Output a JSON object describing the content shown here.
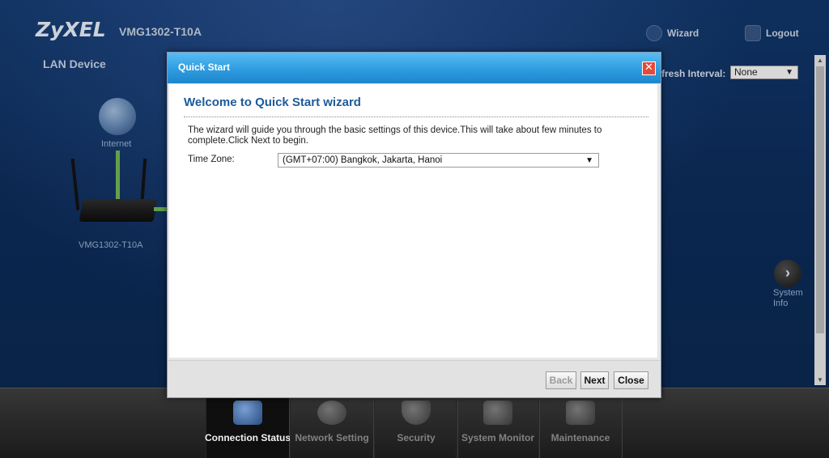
{
  "header": {
    "brand": "ZyXEL",
    "model": "VMG1302-T10A",
    "wizard_label": "Wizard",
    "logout_label": "Logout"
  },
  "page": {
    "section_title": "LAN Device",
    "refresh_label": "fresh Interval:",
    "refresh_value": "None",
    "internet_label": "Internet",
    "device_label": "VMG1302-T10A",
    "system_info_label_1": "System",
    "system_info_label_2": "Info"
  },
  "bottom_nav": {
    "items": [
      {
        "label": "Connection Status",
        "icon": "monitor-globe-icon",
        "active": true
      },
      {
        "label": "Network Setting",
        "icon": "gear-icon",
        "active": false
      },
      {
        "label": "Security",
        "icon": "shield-icon",
        "active": false
      },
      {
        "label": "System Monitor",
        "icon": "chart-monitor-icon",
        "active": false
      },
      {
        "label": "Maintenance",
        "icon": "tools-icon",
        "active": false
      }
    ]
  },
  "dialog": {
    "title": "Quick Start",
    "heading": "Welcome to Quick Start wizard",
    "intro": "The wizard will guide you through the basic settings of this device.This will take about few minutes to complete.Click Next to begin.",
    "timezone_label": "Time Zone:",
    "timezone_value": "(GMT+07:00) Bangkok, Jakarta, Hanoi",
    "back_label": "Back",
    "next_label": "Next",
    "close_label": "Close",
    "close_glyph": "✕"
  },
  "colors": {
    "titlebar_blue": "#2e9ce0",
    "heading_blue": "#1e5a99",
    "close_red": "#e24b3b"
  }
}
